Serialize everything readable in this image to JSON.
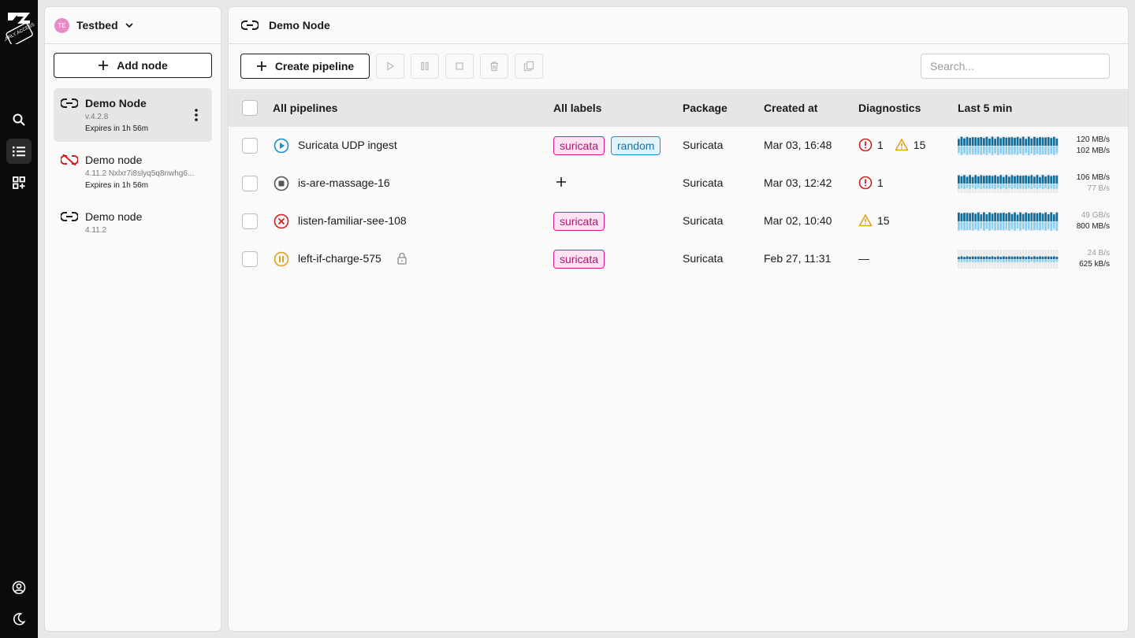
{
  "rail": {
    "logo_text": "EARLY ACCESS",
    "items": [
      "search-icon",
      "list-icon",
      "apps-icon"
    ],
    "bottom": [
      "account-icon",
      "theme-icon"
    ]
  },
  "workspace": {
    "avatar": "TE",
    "name": "Testbed"
  },
  "nodes_panel": {
    "add_label": "Add node",
    "nodes": [
      {
        "name": "Demo Node",
        "version": "v.4.2.8",
        "expires": "Expires in 1h 56m",
        "connected": true
      },
      {
        "name": "Demo node",
        "version": "4.11.2 Nxlxr7i8slyq5q8nwhg6...",
        "expires": "Expires in 1h 56m",
        "connected": false
      },
      {
        "name": "Demo node",
        "version": "4.11.2",
        "expires": "",
        "connected": true
      }
    ]
  },
  "main": {
    "title": "Demo Node",
    "create_label": "Create pipeline",
    "search_placeholder": "Search...",
    "columns": {
      "pipelines": "All pipelines",
      "labels": "All labels",
      "package": "Package",
      "created": "Created at",
      "diagnostics": "Diagnostics",
      "last5": "Last 5 min"
    },
    "rows": [
      {
        "status": "running",
        "name": "Suricata UDP ingest",
        "labels": [
          "suricata",
          "random"
        ],
        "package": "Suricata",
        "created": "Mar 03,  16:48",
        "errors": "1",
        "warnings": "15",
        "rate_in": "120 MB/s",
        "rate_out": "102 MB/s"
      },
      {
        "status": "stopped",
        "name": "is-are-massage-16",
        "labels": [],
        "package": "Suricata",
        "created": "Mar 03,  12:42",
        "errors": "1",
        "warnings": "",
        "rate_in": "106 MB/s",
        "rate_out": "77 B/s"
      },
      {
        "status": "failed",
        "name": "listen-familiar-see-108",
        "labels": [
          "suricata"
        ],
        "package": "Suricata",
        "created": "Mar 02,  10:40",
        "errors": "",
        "warnings": "15",
        "rate_in": "49 GB/s",
        "rate_out": "800 MB/s"
      },
      {
        "status": "paused",
        "name": "left-if-charge-575",
        "labels": [
          "suricata"
        ],
        "package": "Suricata",
        "created": "Feb 27,  11:31",
        "errors": "",
        "warnings": "",
        "diag_empty": "—",
        "rate_in": "24 B/s",
        "rate_out": "625 kB/s"
      }
    ]
  },
  "colors": {
    "running": "#1b8fc9",
    "error": "#d0201f",
    "warning": "#e0a21a",
    "paused": "#e0a21a",
    "spark_dark": "#136b9a",
    "spark_light": "#8fd0ee"
  }
}
